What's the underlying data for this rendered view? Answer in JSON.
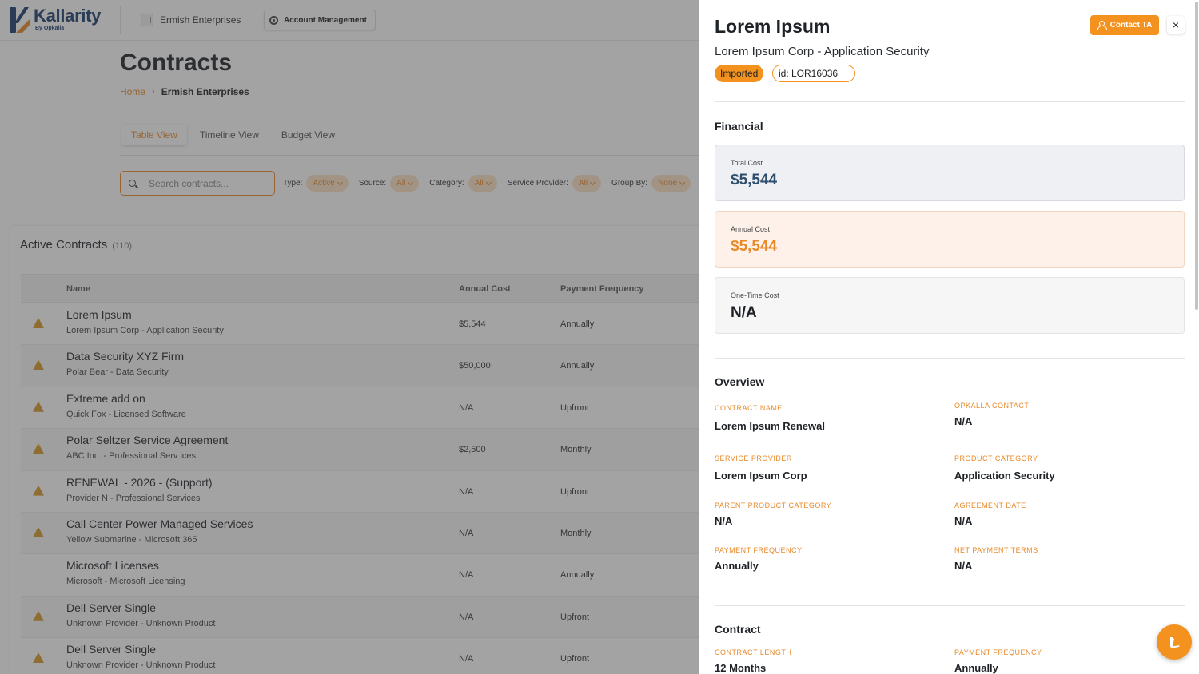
{
  "brand": {
    "name": "Kallarity",
    "byline": "By Opkalla"
  },
  "topbar": {
    "org_name": "Ermish Enterprises",
    "account_label": "Account Management"
  },
  "page": {
    "title": "Contracts",
    "breadcrumb": {
      "home": "Home",
      "current": "Ermish Enterprises"
    }
  },
  "views": [
    "Table View",
    "Timeline View",
    "Budget View"
  ],
  "active_view": "Table View",
  "search": {
    "placeholder": "Search contracts..."
  },
  "filters": [
    {
      "label": "Type:",
      "value": "Active"
    },
    {
      "label": "Source:",
      "value": "All"
    },
    {
      "label": "Category:",
      "value": "All"
    },
    {
      "label": "Service Provider:",
      "value": "All"
    },
    {
      "label": "Group By:",
      "value": "None"
    }
  ],
  "contracts": {
    "title": "Active Contracts",
    "count": "(110)",
    "columns": {
      "name": "Name",
      "annual_cost": "Annual Cost",
      "payment_frequency": "Payment Frequency"
    },
    "rows": [
      {
        "name": "Lorem Ipsum",
        "sub": "Lorem Ipsum Corp - Application Security",
        "cost": "$5,544",
        "freq": "Annually",
        "warn": true
      },
      {
        "name": "Data Security XYZ Firm",
        "sub": "Polar Bear - Data Security",
        "cost": "$50,000",
        "freq": "Annually",
        "warn": true
      },
      {
        "name": "Extreme add on",
        "sub": "Quick Fox - Licensed Software",
        "cost": "N/A",
        "freq": "Upfront",
        "warn": true
      },
      {
        "name": "Polar Seltzer Service Agreement",
        "sub": "ABC Inc. - Professional Serv ices",
        "cost": "$2,500",
        "freq": "Monthly",
        "warn": true
      },
      {
        "name": "RENEWAL - 2026 - (Support)",
        "sub": "Provider N - Professional Services",
        "cost": "N/A",
        "freq": "Upfront",
        "warn": true
      },
      {
        "name": "Call Center Power Managed Services",
        "sub": "Yellow Submarine - Microsoft 365",
        "cost": "N/A",
        "freq": "Monthly",
        "warn": true
      },
      {
        "name": "Microsoft Licenses",
        "sub": "Microsoft - Microsoft Licensing",
        "cost": "N/A",
        "freq": "Annually",
        "warn": false
      },
      {
        "name": "Dell Server Single",
        "sub": "Unknown Provider - Unknown Product",
        "cost": "N/A",
        "freq": "Upfront",
        "warn": true
      },
      {
        "name": "Dell Server Single",
        "sub": "Unknown Provider - Unknown Product",
        "cost": "N/A",
        "freq": "Upfront",
        "warn": true
      }
    ]
  },
  "drawer": {
    "title": "Lorem Ipsum",
    "subtitle": "Lorem Ipsum Corp - Application Security",
    "contact_label": "Contact TA",
    "close_label": "×",
    "badge_status": "Imported",
    "badge_id": "id: LOR16036",
    "financial": {
      "heading": "Financial",
      "total": {
        "label": "Total Cost",
        "value": "$5,544"
      },
      "annual": {
        "label": "Annual Cost",
        "value": "$5,544"
      },
      "onetime": {
        "label": "One-Time Cost",
        "value": "N/A"
      }
    },
    "overview": {
      "heading": "Overview",
      "contract_name": {
        "label": "CONTRACT NAME",
        "value": "Lorem Ipsum Renewal"
      },
      "opkalla_contact": {
        "label": "OPKALLA CONTACT",
        "value": "N/A"
      },
      "service_provider": {
        "label": "SERVICE PROVIDER",
        "value": "Lorem Ipsum Corp"
      },
      "product_category": {
        "label": "PRODUCT CATEGORY",
        "value": "Application Security"
      },
      "parent_product_category": {
        "label": "PARENT PRODUCT CATEGORY",
        "value": "N/A"
      },
      "agreement_date": {
        "label": "AGREEMENT DATE",
        "value": "N/A"
      },
      "payment_frequency": {
        "label": "PAYMENT FREQUENCY",
        "value": "Annually"
      },
      "net_payment_terms": {
        "label": "NET PAYMENT TERMS",
        "value": "N/A"
      }
    },
    "contract": {
      "heading": "Contract",
      "contract_length": {
        "label": "CONTRACT LENGTH",
        "value": "12 Months"
      },
      "payment_frequency": {
        "label": "PAYMENT FREQUENCY",
        "value": "Annually"
      }
    }
  },
  "colors": {
    "accent": "#f3921f",
    "brand_navy": "#1d3f6e",
    "overlay": "#3c3c3c"
  }
}
